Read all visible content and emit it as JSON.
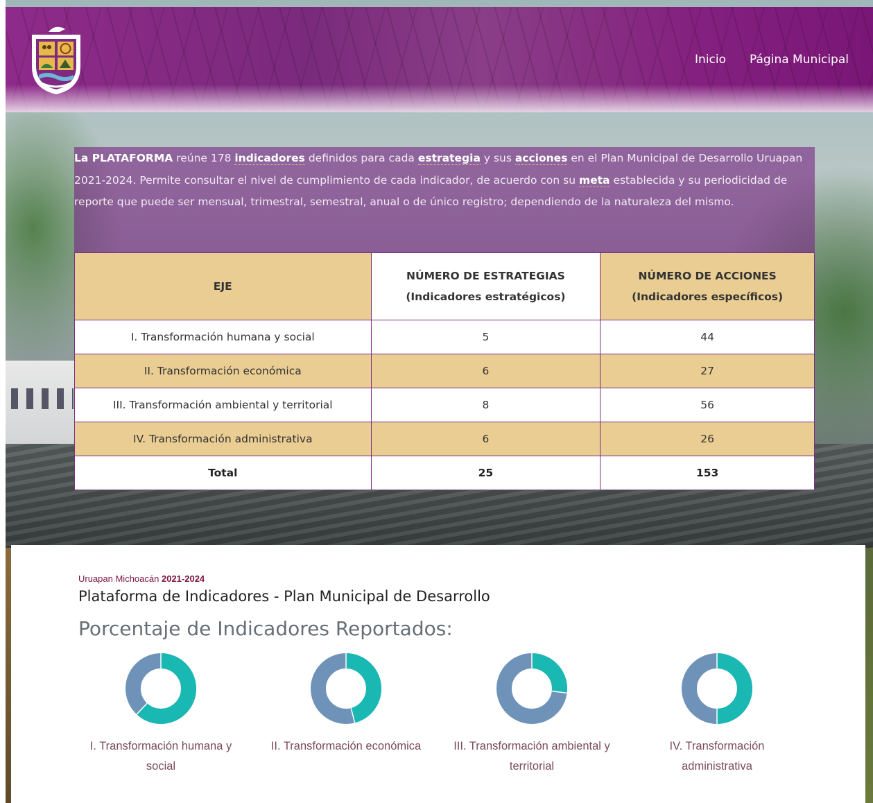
{
  "header": {
    "nav": [
      {
        "label": "Inicio"
      },
      {
        "label": "Página Municipal"
      }
    ]
  },
  "intro": {
    "p1": "La PLATAFORMA",
    "p2": " reúne 178 ",
    "p3": "indicadores",
    "p4": " definidos para cada ",
    "p5": "estrategia",
    "p6": " y sus ",
    "p7": "acciones",
    "p8": " en el Plan Municipal de Desarrollo Uruapan 2021-2024. Permite consultar el nivel de cumplimiento de cada indicador, de acuerdo con su ",
    "p9": "meta",
    "p10": " establecida y su periodicidad de reporte que puede ser mensual, trimestral, semestral, anual o de único registro; dependiendo de la naturaleza del mismo."
  },
  "table": {
    "headers": {
      "eje": "EJE",
      "estrategias": "NÚMERO DE ESTRATEGIAS",
      "estrategias_sub": "(Indicadores estratégicos)",
      "acciones": "NÚMERO DE ACCIONES",
      "acciones_sub": "(Indicadores específicos)"
    },
    "rows": [
      {
        "eje": "I. Transformación humana y social",
        "estrategias": "5",
        "acciones": "44"
      },
      {
        "eje": "II. Transformación económica",
        "estrategias": "6",
        "acciones": "27"
      },
      {
        "eje": "III. Transformación ambiental y territorial",
        "estrategias": "8",
        "acciones": "56"
      },
      {
        "eje": "IV. Transformación administrativa",
        "estrategias": "6",
        "acciones": "26"
      }
    ],
    "total": {
      "label": "Total",
      "estrategias": "25",
      "acciones": "153"
    }
  },
  "card": {
    "city": "Uruapan Michoacán",
    "period": "2021-2024",
    "title": "Plataforma de Indicadores - Plan Municipal de Desarrollo",
    "pct_title": "Porcentaje de Indicadores Reportados:"
  },
  "chart_data": {
    "type": "pie",
    "colors": {
      "reported": "#1ab8b3",
      "pending": "#6f93b8"
    },
    "donuts": [
      {
        "label": "I. Transformación humana y social",
        "reported_fraction": 0.62
      },
      {
        "label": "II. Transformación económica",
        "reported_fraction": 0.46
      },
      {
        "label": "III. Transformación ambiental y territorial",
        "reported_fraction": 0.27
      },
      {
        "label": "IV. Transformación administrativa",
        "reported_fraction": 0.5
      }
    ]
  }
}
